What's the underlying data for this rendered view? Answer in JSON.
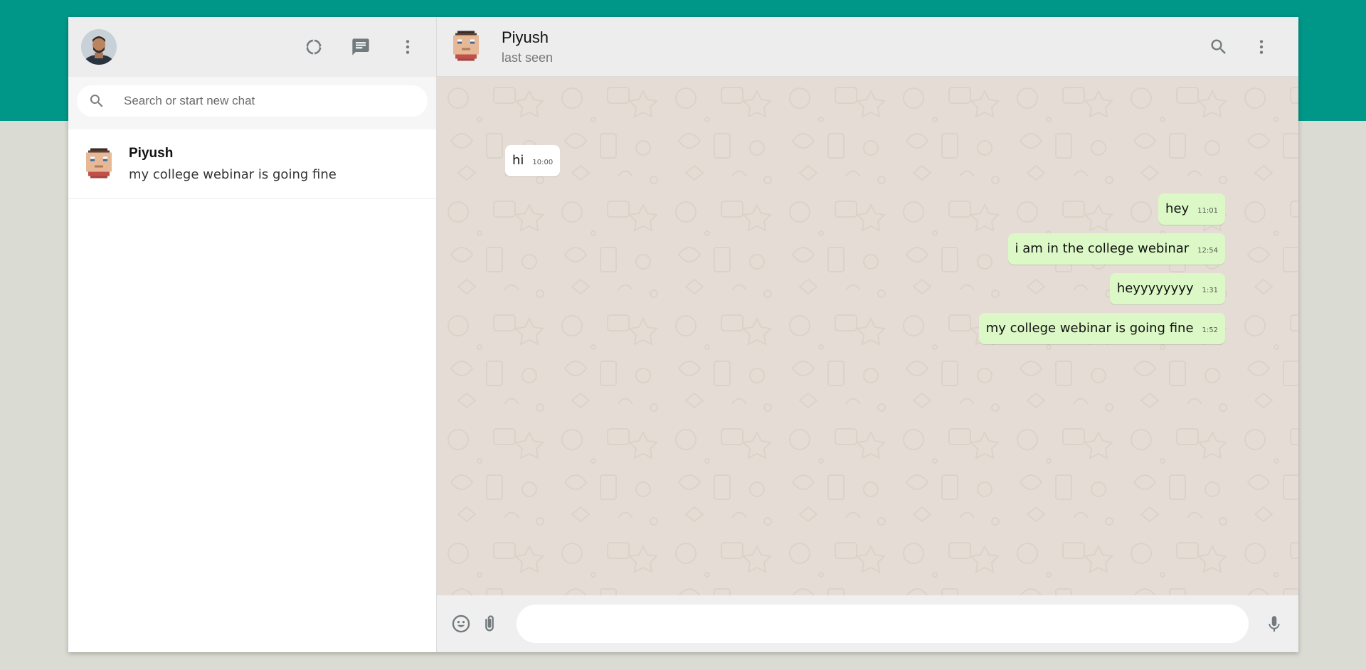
{
  "sidebar": {
    "search": {
      "placeholder": "Search or start new chat"
    },
    "chats": [
      {
        "name": "Piyush",
        "last_message": "my college webinar is going fine"
      }
    ]
  },
  "conversation": {
    "contact_name": "Piyush",
    "contact_status": "last seen",
    "messages": [
      {
        "direction": "in",
        "text": "hi",
        "time": "10:00"
      },
      {
        "direction": "out",
        "text": "hey",
        "time": "11:01"
      },
      {
        "direction": "out",
        "text": "i am in the college webinar",
        "time": "12:54"
      },
      {
        "direction": "out",
        "text": "heyyyyyyyy",
        "time": "1:31"
      },
      {
        "direction": "out",
        "text": "my college webinar is going fine",
        "time": "1:52"
      }
    ],
    "composer": {
      "value": ""
    }
  },
  "colors": {
    "brand_band": "#009688",
    "header_bg": "#ededed",
    "outgoing_bubble": "#dcf8c6",
    "incoming_bubble": "#ffffff",
    "chat_bg": "#e5ddd5"
  },
  "icons": [
    "status-icon",
    "new-chat-icon",
    "menu-icon",
    "search-icon",
    "emoji-icon",
    "attach-icon",
    "mic-icon"
  ]
}
